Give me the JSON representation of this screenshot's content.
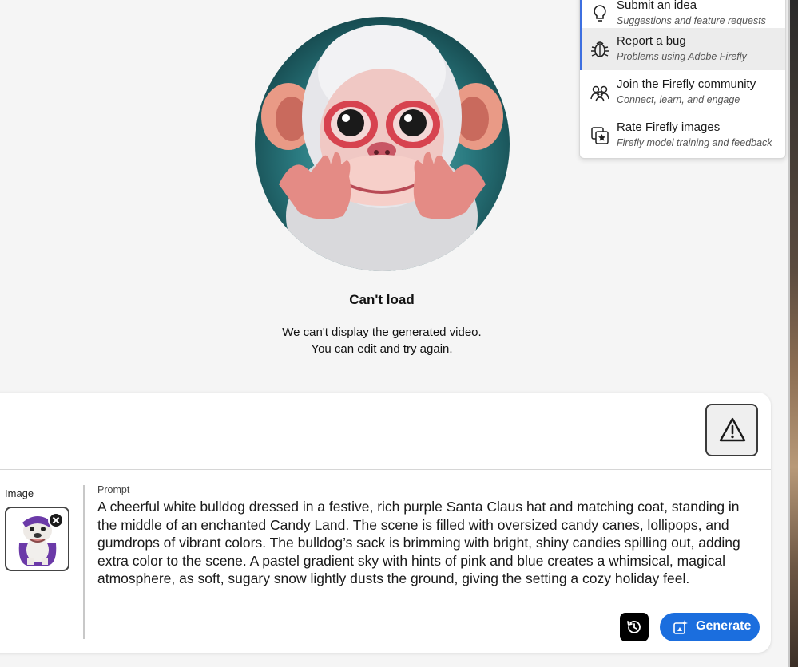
{
  "help_menu": {
    "items": [
      {
        "label": "Submit an idea",
        "description": "Suggestions and feature requests",
        "icon": "lightbulb-icon"
      },
      {
        "label": "Report a bug",
        "description": "Problems using Adobe Firefly",
        "icon": "bug-icon"
      },
      {
        "label": "Join the Firefly community",
        "description": "Connect, learn, and engage",
        "icon": "community-icon"
      },
      {
        "label": "Rate Firefly images",
        "description": "Firefly model training and feedback",
        "icon": "rate-image-icon"
      }
    ]
  },
  "error": {
    "title": "Can't load",
    "message_line1": "We can't display the generated video.",
    "message_line2": "You can edit and try again."
  },
  "panel": {
    "image_label": "Image",
    "prompt_label": "Prompt",
    "prompt_text": "A cheerful white bulldog dressed in a festive, rich purple Santa Claus hat and matching coat, standing in the middle of an enchanted Candy Land. The scene is filled with oversized candy canes, lollipops, and gumdrops of vibrant colors. The bulldog’s sack is brimming with bright, shiny candies spilling out, adding extra color to the scene. A pastel gradient sky with hints of pink and blue creates a whimsical, magical atmosphere, as soft, sugary snow lightly dusts the ground, giving the setting a cozy holiday feel.",
    "generate_label": "Generate"
  },
  "colors": {
    "accent": "#1b6ede",
    "menu_highlight": "#3d6fe0"
  }
}
